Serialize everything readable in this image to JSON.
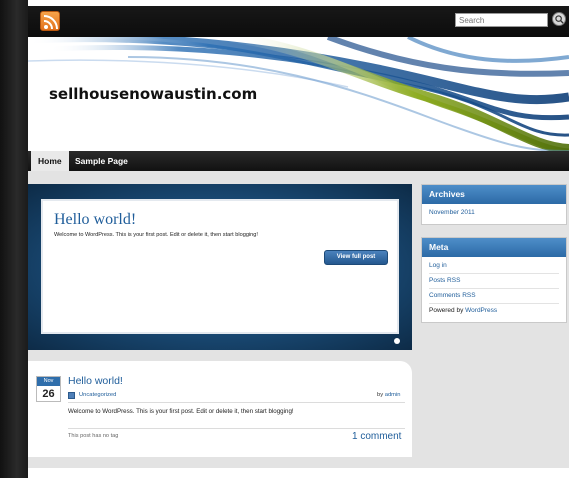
{
  "site": {
    "title": "sellhousenowaustin.com",
    "search_placeholder": "Search"
  },
  "nav": {
    "items": [
      {
        "label": "Home",
        "active": true
      },
      {
        "label": "Sample Page",
        "active": false
      }
    ]
  },
  "feature": {
    "title": "Hello world!",
    "excerpt": "Welcome to WordPress. This is your first post. Edit or delete it, then start blogging!",
    "button_label": "View full post"
  },
  "sidebar": {
    "archives": {
      "title": "Archives",
      "items": [
        "November 2011"
      ]
    },
    "meta": {
      "title": "Meta",
      "items": [
        "Log in",
        "Posts RSS",
        "Comments RSS"
      ],
      "powered_prefix": "Powered by ",
      "powered_link": "WordPress"
    }
  },
  "post": {
    "date_month": "Nov",
    "date_day": "26",
    "title": "Hello world!",
    "category": "Uncategorized",
    "byline_prefix": "by ",
    "author": "admin",
    "excerpt": "Welcome to WordPress. This is your first post. Edit or delete it, then start blogging!",
    "tags": "This post has no tag",
    "comments": "1 comment"
  },
  "colors": {
    "accent_blue": "#1f5d9a",
    "widget_blue": "#3a7cb9",
    "rss_orange": "#f08a2c"
  },
  "icons": {
    "rss": "rss-icon",
    "search": "search-icon",
    "category": "folder-icon"
  }
}
